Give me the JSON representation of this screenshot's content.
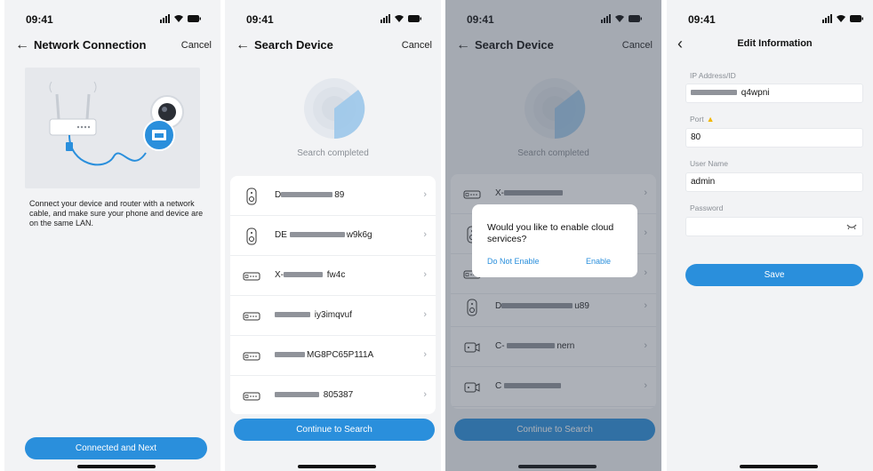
{
  "status": {
    "time": "09:41"
  },
  "screen1": {
    "title": "Network Connection",
    "cancel": "Cancel",
    "description": "Connect your device and router with a network cable, and make sure your phone and device are on the same LAN.",
    "button": "Connected and Next"
  },
  "screen2": {
    "title": "Search Device",
    "cancel": "Cancel",
    "search_status": "Search completed",
    "devices": [
      {
        "icon": "doorbell-icon",
        "name_suffix": "89"
      },
      {
        "icon": "doorbell-icon",
        "name_prefix": "DE",
        "name_suffix": "w9k6g"
      },
      {
        "icon": "nvr-icon",
        "name_prefix": "X-",
        "name_suffix": "fw4c"
      },
      {
        "icon": "nvr-icon",
        "name_suffix": "iy3imqvuf"
      },
      {
        "icon": "nvr-icon",
        "name_suffix": "MG8PC65P111A"
      },
      {
        "icon": "nvr-icon",
        "name_suffix": "805387"
      }
    ],
    "button": "Continue to Search"
  },
  "screen3": {
    "title": "Search Device",
    "cancel": "Cancel",
    "search_status": "Search completed",
    "devices": [
      {
        "icon": "nvr-icon",
        "name_prefix": "X-"
      },
      {
        "icon": "doorbell-icon"
      },
      {
        "icon": "nvr-icon"
      },
      {
        "icon": "doorbell-icon",
        "name_prefix": "D",
        "name_suffix": "u89"
      },
      {
        "icon": "camera-icon",
        "name_prefix": "C-",
        "name_suffix": "nern"
      },
      {
        "icon": "camera-icon",
        "name_prefix": "C"
      }
    ],
    "dialog": {
      "message": "Would you like to enable cloud services?",
      "decline": "Do Not Enable",
      "accept": "Enable"
    },
    "button": "Continue to Search"
  },
  "screen4": {
    "title": "Edit Information",
    "fields": {
      "ip_label": "IP Address/ID",
      "ip_value_suffix": "q4wpni",
      "port_label": "Port",
      "port_value": "80",
      "user_label": "User Name",
      "user_value": "admin",
      "password_label": "Password",
      "password_value": ""
    },
    "button": "Save"
  },
  "colors": {
    "accent": "#2a8fdc",
    "background": "#f2f3f5",
    "warning": "#f2b600"
  }
}
